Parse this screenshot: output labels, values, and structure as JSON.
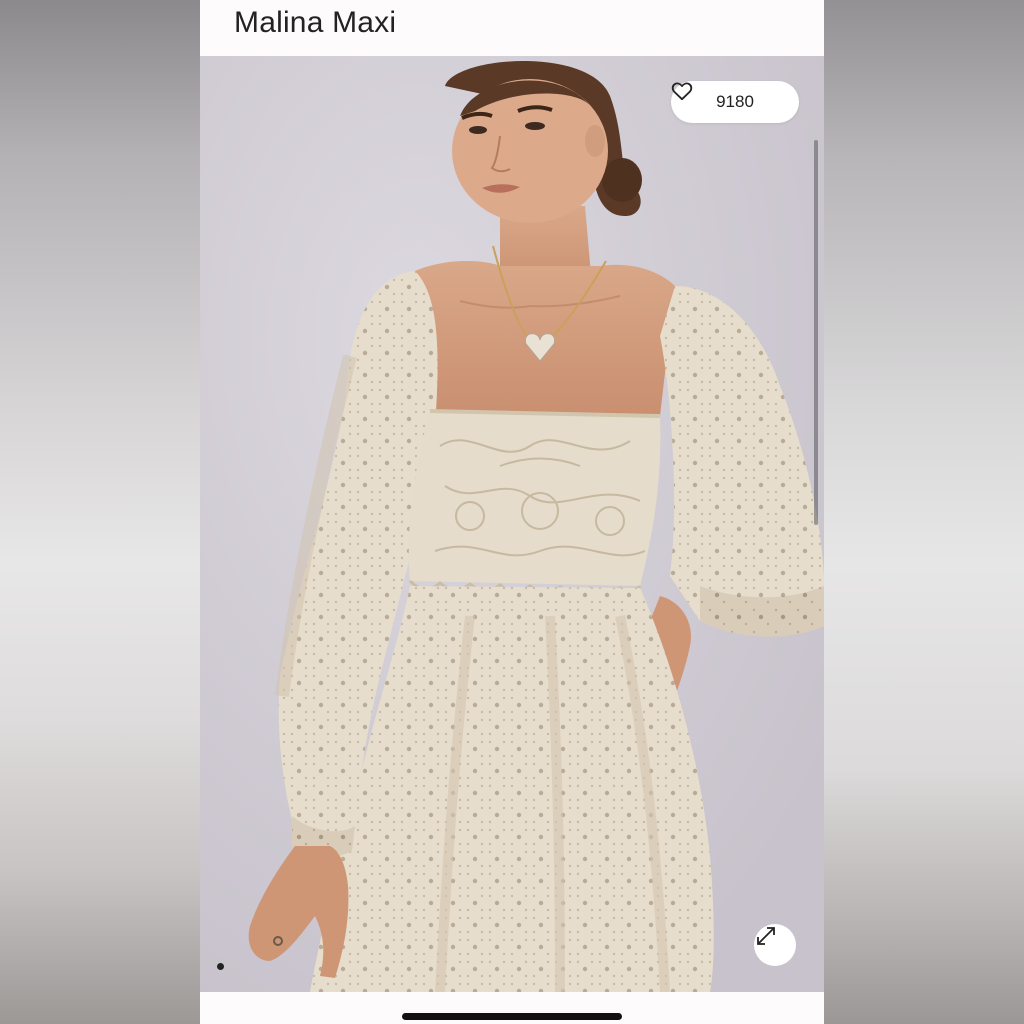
{
  "product": {
    "title": "Malina Maxi"
  },
  "favorites": {
    "count": "9180",
    "icon": "heart-outline-icon"
  },
  "gallery": {
    "current_index": 1,
    "expand_icon": "expand-arrows-icon"
  },
  "colors": {
    "page_background": "#fdfbfb",
    "photo_backdrop": "#cfcbd3",
    "dress": "#e6dccb"
  }
}
